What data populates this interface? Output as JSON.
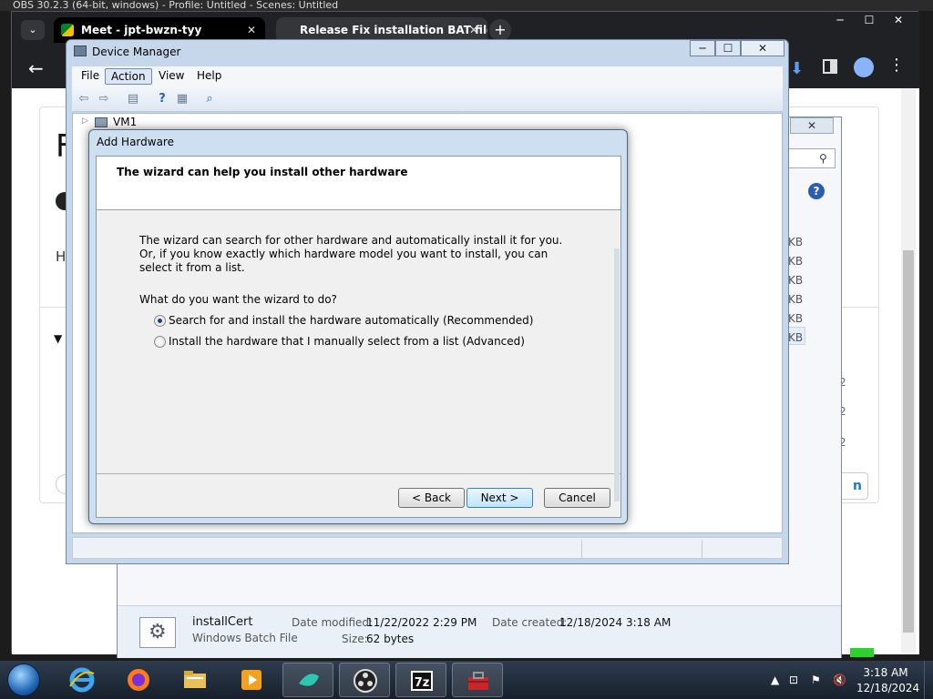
{
  "obs": {
    "title": "OBS 30.2.3 (64-bit, windows) - Profile: Untitled - Scenes: Untitled"
  },
  "chrome": {
    "tabs": [
      {
        "label": "Meet - jpt-bwzn-tyy"
      },
      {
        "label": "Release Fix installation BAT file"
      }
    ],
    "page": {
      "title_fragment": "F",
      "text_fragment": "H",
      "button_fragment": "n"
    }
  },
  "explorer": {
    "list_sizes": [
      "KB",
      "KB",
      "KB",
      "KB",
      "KB",
      "KB"
    ],
    "row_nums": [
      "2",
      "2",
      "2"
    ],
    "details": {
      "file_name": "installCert",
      "file_type": "Windows Batch File",
      "date_modified_label": "Date modified:",
      "date_modified": "11/22/2022 2:29 PM",
      "date_created_label": "Date created:",
      "date_created": "12/18/2024 3:18 AM",
      "size_label": "Size:",
      "size": "62 bytes"
    }
  },
  "device_manager": {
    "title": "Device Manager",
    "menu": [
      "File",
      "Action",
      "View",
      "Help"
    ],
    "tree_root": "VM1"
  },
  "wizard": {
    "title": "Add Hardware",
    "heading": "The wizard can help you install other hardware",
    "intro": "The wizard can search for other hardware and automatically install it for you. Or, if you know exactly which hardware model you want to install, you can select it from a list.",
    "question": "What do you want the wizard to do?",
    "options": [
      {
        "label": "Search for and install the hardware automatically (Recommended)",
        "selected": true
      },
      {
        "label": "Install the hardware that I manually select from a list (Advanced)",
        "selected": false
      }
    ],
    "buttons": {
      "back": "< Back",
      "next": "Next >",
      "cancel": "Cancel"
    }
  },
  "taskbar": {
    "apps": [
      "internet-explorer-icon",
      "firefox-icon",
      "file-explorer-icon",
      "media-player-icon",
      "meet-app-icon",
      "obs-icon",
      "7zip-icon",
      "toolbox-icon"
    ],
    "time": "3:18 AM",
    "date": "12/18/2024"
  },
  "colors": {
    "taskbar": "#1b2533",
    "wizard_frame": "#cddff0",
    "next_button": "#bee6fd"
  }
}
